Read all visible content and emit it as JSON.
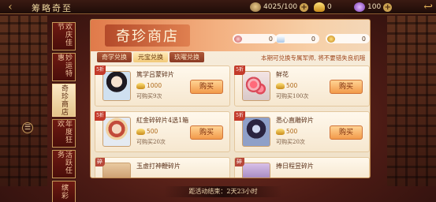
{
  "topbar": {
    "title": "筹略奇至",
    "resource_1": "4025/100",
    "resource_2": "0",
    "resource_3": "100",
    "back_icon": "back-arrow-icon",
    "exit_icon": "exit-icon"
  },
  "sidenav": {
    "items": [
      {
        "label": "欢庆佳节"
      },
      {
        "label": "妙运特惠"
      },
      {
        "label": "奇珍商店"
      },
      {
        "label": "年度狂欢"
      },
      {
        "label": "活跃任务"
      },
      {
        "label": "缤彩"
      }
    ]
  },
  "shop": {
    "title": "奇珍商店",
    "currency_1": "0",
    "currency_2": "0",
    "currency_3": "0",
    "tabs": [
      "奇学兑换",
      "元宝兑换",
      "玖曜兑换"
    ],
    "notice": "本期可兑换专属军师, 将不要错失良机哦",
    "items": [
      {
        "badge": "5折",
        "name": "篤学吕蒙碎片",
        "price": "1000",
        "limit": "可购买9次",
        "buy": "购买"
      },
      {
        "badge": "5折",
        "name": "鲜花",
        "price": "500",
        "limit": "可购买100次",
        "buy": "购买"
      },
      {
        "badge": "5折",
        "name": "紅金碎碎片4选1箱",
        "price": "500",
        "limit": "可购买20次",
        "buy": "购买"
      },
      {
        "badge": "5折",
        "name": "悉心直雕碎片",
        "price": "500",
        "limit": "可购买20次",
        "buy": "购买"
      },
      {
        "badge": "碎",
        "name": "玉虚打神鞭碎片"
      },
      {
        "badge": "碎",
        "name": "捧日程昱碎片"
      }
    ]
  },
  "footer": {
    "countdown": "距活动结束：2天23小时"
  }
}
